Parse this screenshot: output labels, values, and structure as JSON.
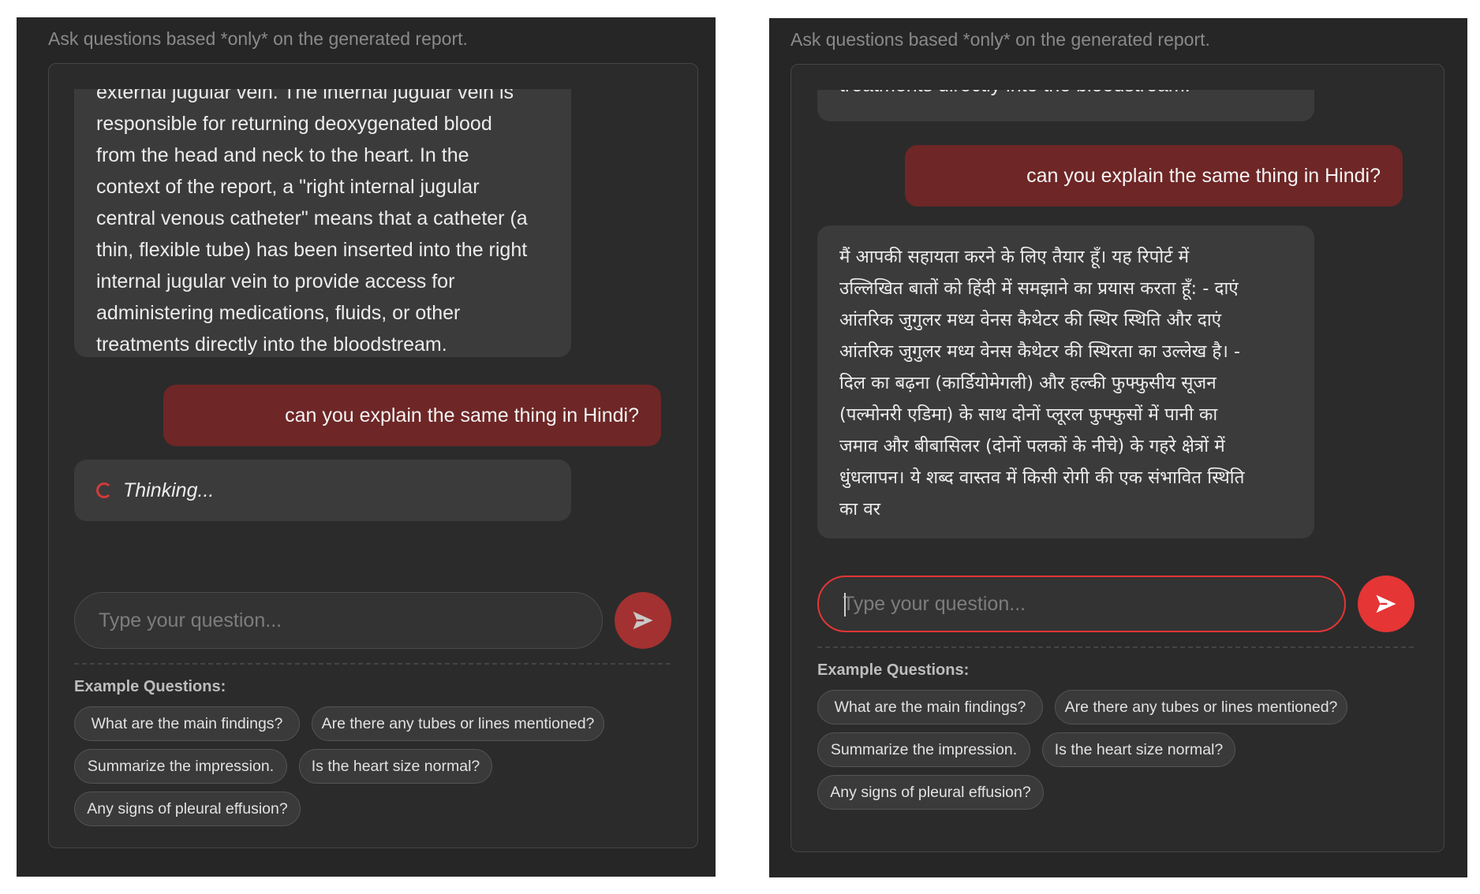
{
  "instruction": "Ask questions based *only* on the generated report.",
  "input_placeholder": "Type your question...",
  "examples_heading": "Example Questions:",
  "examples": [
    "What are the main findings?",
    "Are there any tubes or lines mentioned?",
    "Summarize the impression.",
    "Is the heart size normal?",
    "Any signs of pleural effusion?"
  ],
  "colors": {
    "send_button_disabled": "#a33131",
    "send_button_active": "#e53535",
    "user_bubble": "#6e2626",
    "input_focus_border": "#e53535"
  },
  "left": {
    "bot_message_lines": [
      "external jugular vein. The internal jugular vein is",
      "responsible for returning deoxygenated blood",
      "from the head and neck to the heart. In the",
      "context of the report, a \"right internal jugular",
      "central venous catheter\" means that a catheter (a",
      "thin, flexible tube) has been inserted into the right",
      "internal jugular vein to provide access for",
      "administering medications, fluids, or other",
      "treatments directly into the bloodstream."
    ],
    "user_message": "can you explain the same thing in Hindi?",
    "thinking_text": "Thinking..."
  },
  "right": {
    "bot_tail_line": "treatments directly into the bloodstream.",
    "user_message": "can you explain the same thing in Hindi?",
    "hindi_lines": [
      "मैं आपकी सहायता करने के लिए तैयार हूँ। यह रिपोर्ट में",
      "उल्लिखित बातों को हिंदी में समझाने का प्रयास करता हूँ: - दाएं",
      "आंतरिक जुगुलर मध्य वेनस कैथेटर की स्थिर स्थिति और दाएं",
      "आंतरिक जुगुलर मध्य वेनस कैथेटर की स्थिरता का उल्लेख है। -",
      "दिल का बढ़ना (कार्डियोमेगली) और हल्की फुफ्फुसीय सूजन",
      "(पल्मोनरी एडिमा) के साथ दोनों प्लूरल फुफ्फुसों में पानी का",
      "जमाव और बीबासिलर (दोनों पलकों के नीचे) के गहरे क्षेत्रों में",
      "धुंधलापन। ये शब्द वास्तव में किसी रोगी की एक संभावित स्थिति",
      "का वर"
    ]
  }
}
